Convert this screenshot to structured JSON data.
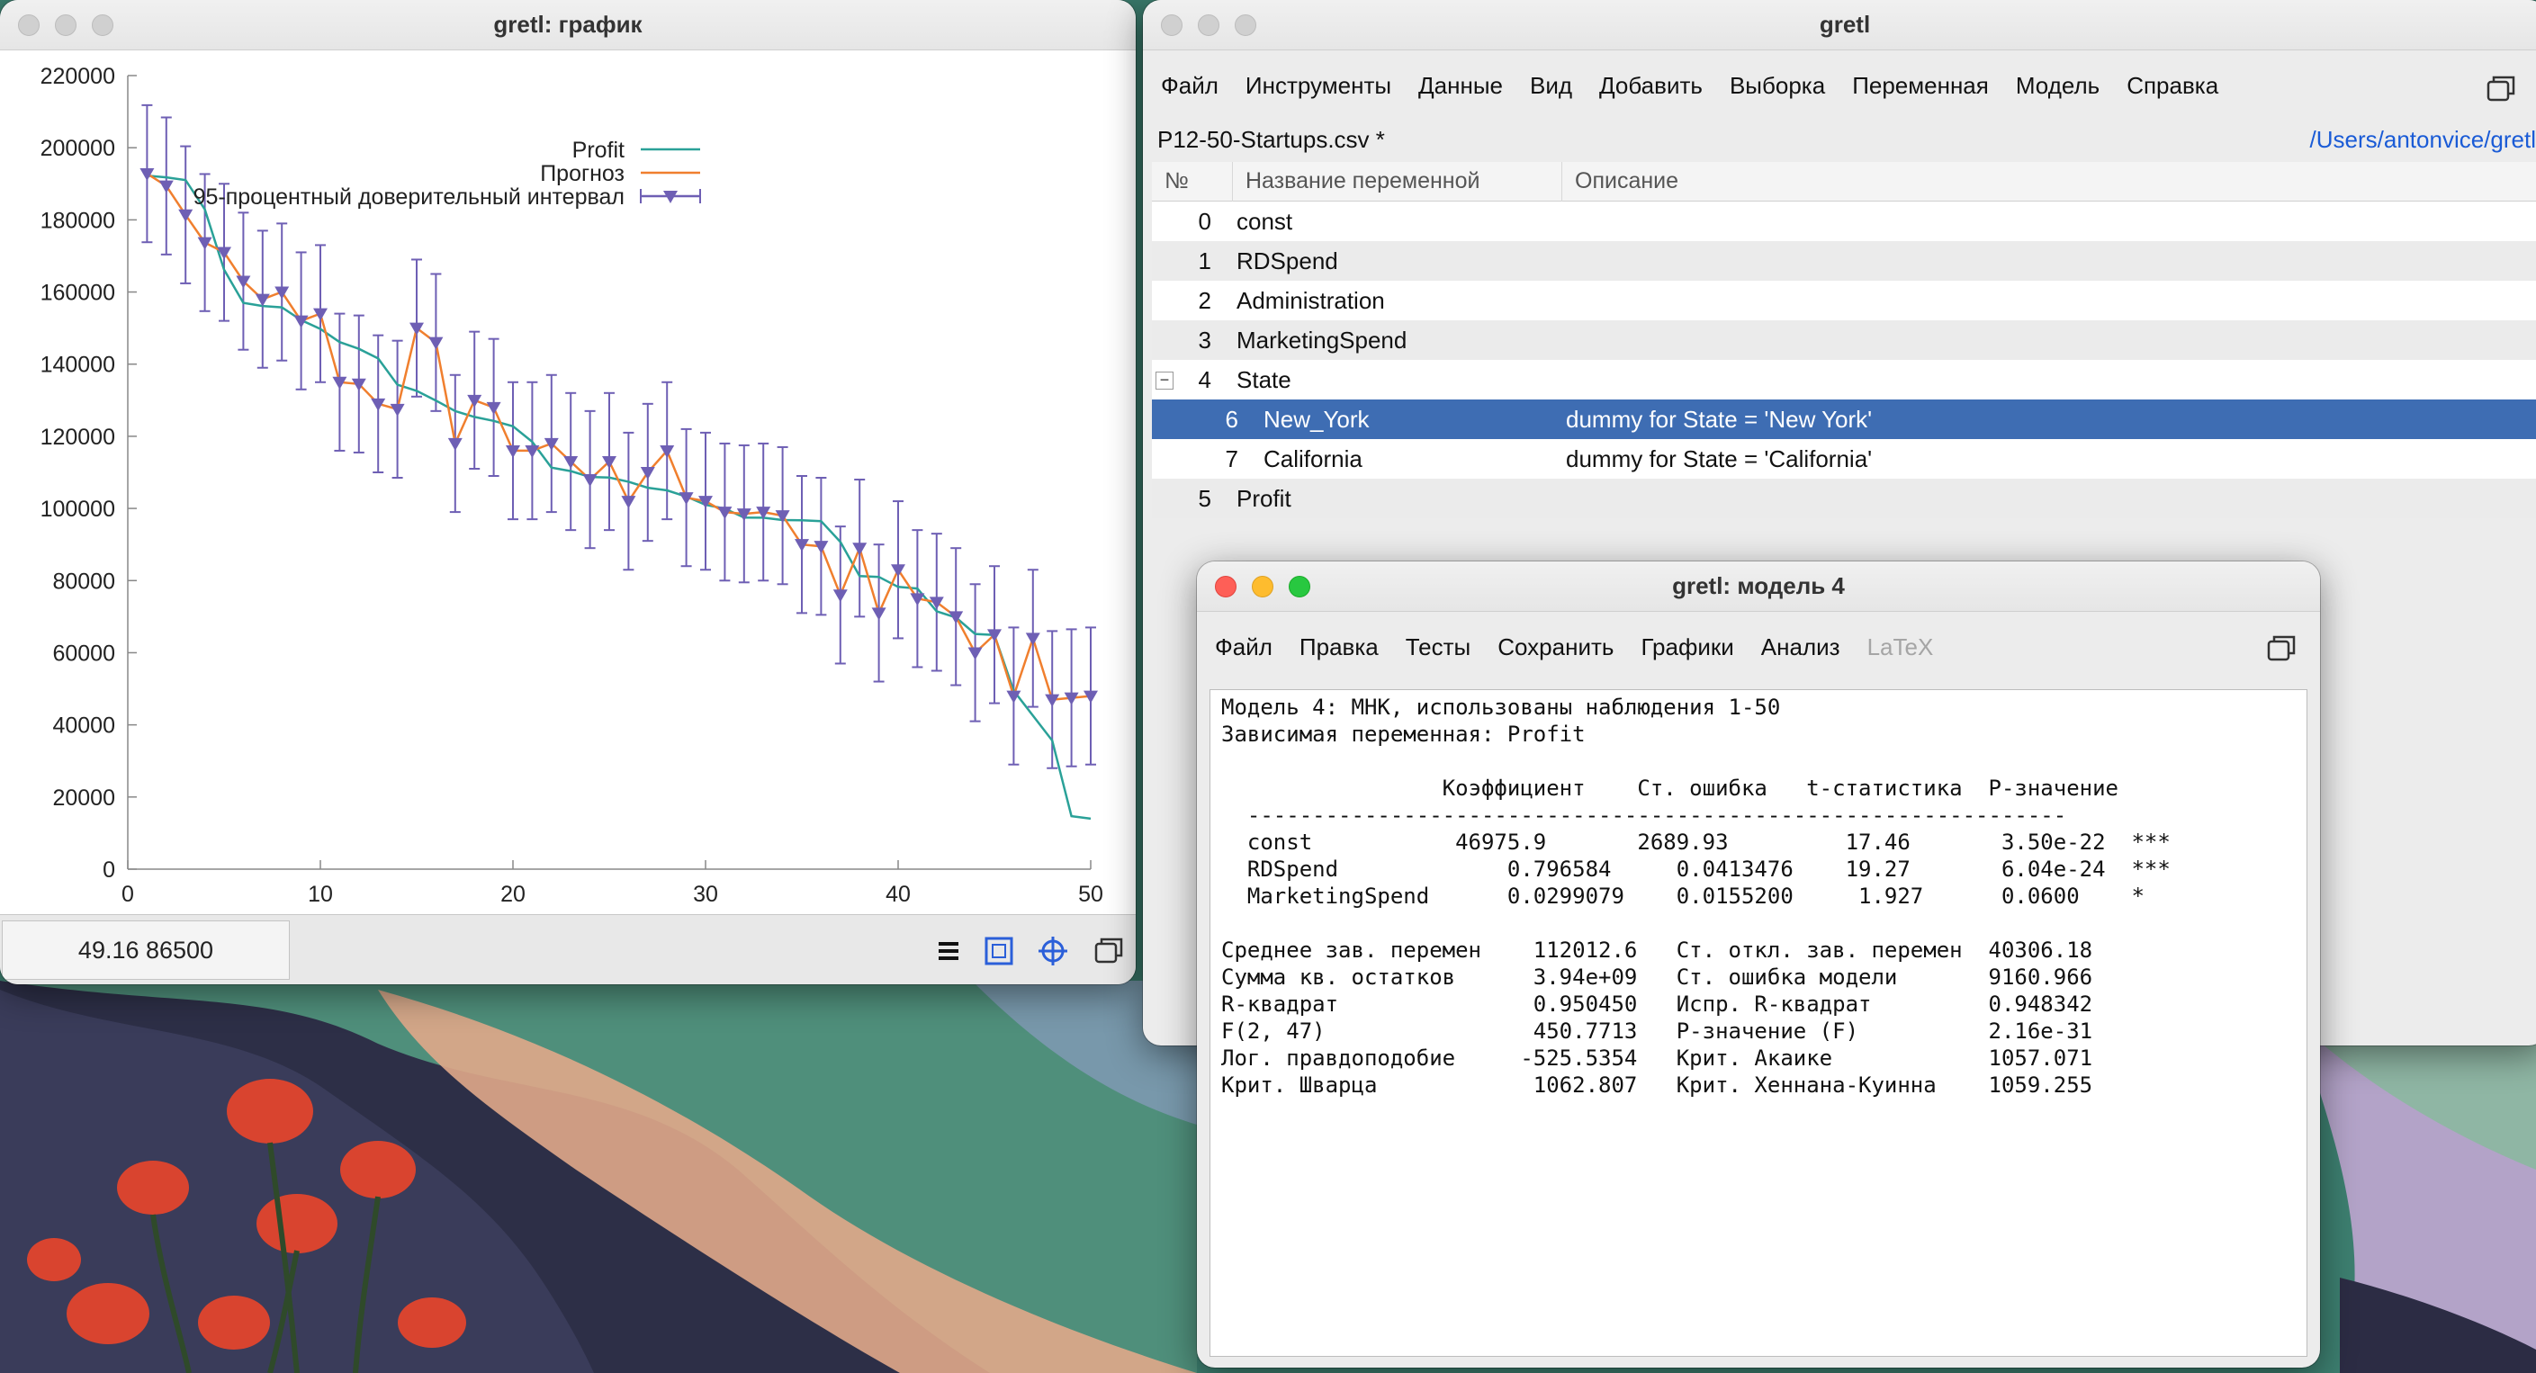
{
  "plot_window": {
    "title": "gretl: график",
    "coords": "49.16 86500",
    "toolbar_icons": [
      "menu-icon",
      "zoom-icon",
      "target-icon",
      "restore-icon"
    ]
  },
  "chart_data": {
    "type": "line",
    "title": "",
    "xlabel": "",
    "ylabel": "",
    "xlim": [
      0,
      50
    ],
    "ylim": [
      0,
      220000
    ],
    "xticks": [
      "0",
      "10",
      "20",
      "30",
      "40",
      "50"
    ],
    "yticks": [
      "0",
      "20000",
      "40000",
      "60000",
      "80000",
      "100000",
      "120000",
      "140000",
      "160000",
      "180000",
      "200000",
      "220000"
    ],
    "legend_position": "top-right",
    "series": [
      {
        "name": "Profit",
        "color": "#2aa198",
        "x": [
          1,
          2,
          3,
          4,
          5,
          6,
          7,
          8,
          9,
          10,
          11,
          12,
          13,
          14,
          15,
          16,
          17,
          18,
          19,
          20,
          21,
          22,
          23,
          24,
          25,
          26,
          27,
          28,
          29,
          30,
          31,
          32,
          33,
          34,
          35,
          36,
          37,
          38,
          39,
          40,
          41,
          42,
          43,
          44,
          45,
          46,
          47,
          48,
          49,
          50
        ],
        "y": [
          192262,
          191792,
          191050,
          182902,
          166188,
          156991,
          156123,
          155753,
          152212,
          149760,
          146122,
          144259,
          141586,
          134307,
          132603,
          129917,
          126993,
          125370,
          124267,
          122777,
          118474,
          111313,
          110352,
          108734,
          108552,
          107404,
          105734,
          105008,
          103282,
          101004,
          99938,
          97484,
          97427,
          96779,
          96713,
          96480,
          90709,
          81229,
          81006,
          78240,
          77798,
          71498,
          69759,
          65200,
          64926,
          49491,
          42560,
          35673,
          14681,
          14000
        ]
      },
      {
        "name": "Прогноз",
        "color": "#f07f2e",
        "x": [
          1,
          2,
          3,
          4,
          5,
          6,
          7,
          8,
          9,
          10,
          11,
          12,
          13,
          14,
          15,
          16,
          17,
          18,
          19,
          20,
          21,
          22,
          23,
          24,
          25,
          26,
          27,
          28,
          29,
          30,
          31,
          32,
          33,
          34,
          35,
          36,
          37,
          38,
          39,
          40,
          41,
          42,
          43,
          44,
          45,
          46,
          47,
          48,
          49,
          50
        ],
        "y": [
          192800,
          189400,
          181400,
          173700,
          171000,
          163000,
          158000,
          160000,
          152000,
          154000,
          135000,
          134500,
          129000,
          127500,
          150000,
          146000,
          118000,
          130000,
          128000,
          116000,
          116000,
          118000,
          113000,
          108000,
          113000,
          102000,
          110000,
          116000,
          103000,
          102000,
          99000,
          98500,
          99000,
          98000,
          90000,
          89500,
          76000,
          89000,
          71000,
          83000,
          75000,
          74000,
          70000,
          60000,
          65000,
          48000,
          64000,
          47000,
          47500,
          48000
        ]
      },
      {
        "name": "95-процентный доверительный интервал",
        "color": "#6e5fb4",
        "x": [
          1,
          2,
          3,
          4,
          5,
          6,
          7,
          8,
          9,
          10,
          11,
          12,
          13,
          14,
          15,
          16,
          17,
          18,
          19,
          20,
          21,
          22,
          23,
          24,
          25,
          26,
          27,
          28,
          29,
          30,
          31,
          32,
          33,
          34,
          35,
          36,
          37,
          38,
          39,
          40,
          41,
          42,
          43,
          44,
          45,
          46,
          47,
          48,
          49,
          50
        ],
        "y": [
          192800,
          189400,
          181400,
          173700,
          171000,
          163000,
          158000,
          160000,
          152000,
          154000,
          135000,
          134500,
          129000,
          127500,
          150000,
          146000,
          118000,
          130000,
          128000,
          116000,
          116000,
          118000,
          113000,
          108000,
          113000,
          102000,
          110000,
          116000,
          103000,
          102000,
          99000,
          98500,
          99000,
          98000,
          90000,
          89500,
          76000,
          89000,
          71000,
          83000,
          75000,
          74000,
          70000,
          60000,
          65000,
          48000,
          64000,
          47000,
          47500,
          48000
        ],
        "half_width": 19000
      }
    ]
  },
  "main_window": {
    "title": "gretl",
    "menu": [
      "Файл",
      "Инструменты",
      "Данные",
      "Вид",
      "Добавить",
      "Выборка",
      "Переменная",
      "Модель",
      "Справка"
    ],
    "file_name": "P12-50-Startups.csv *",
    "file_path": "/Users/antonvice/gretl",
    "table": {
      "headers": [
        "№",
        "Название переменной",
        "Описание"
      ],
      "rows": [
        {
          "no": "0",
          "name": "const",
          "desc": ""
        },
        {
          "no": "1",
          "name": "RDSpend",
          "desc": ""
        },
        {
          "no": "2",
          "name": "Administration",
          "desc": ""
        },
        {
          "no": "3",
          "name": "MarketingSpend",
          "desc": ""
        },
        {
          "no": "4",
          "name": "State",
          "desc": ""
        },
        {
          "no": "6",
          "name": "New_York",
          "desc": "dummy for State = 'New York'"
        },
        {
          "no": "7",
          "name": "California",
          "desc": "dummy for State = 'California'"
        },
        {
          "no": "5",
          "name": "Profit",
          "desc": ""
        }
      ]
    }
  },
  "model_window": {
    "title": "gretl: модель 4",
    "menu": [
      "Файл",
      "Правка",
      "Тесты",
      "Сохранить",
      "Графики",
      "Анализ"
    ],
    "menu_disabled": "LaTeX",
    "text_lines": [
      "Модель 4: МНК, использованы наблюдения 1-50",
      "Зависимая переменная: Profit",
      "",
      "                 Коэффициент    Ст. ошибка   t-статистика  P-значение",
      "  ---------------------------------------------------------------",
      "  const           46975.9       2689.93         17.46       3.50e-22  ***",
      "  RDSpend             0.796584     0.0413476    19.27       6.04e-24  ***",
      "  MarketingSpend      0.0299079    0.0155200     1.927      0.0600    *",
      "",
      "Среднее зав. перемен    112012.6   Ст. откл. зав. перемен  40306.18",
      "Сумма кв. остатков      3.94e+09   Ст. ошибка модели       9160.966",
      "R-квадрат               0.950450   Испр. R-квадрат         0.948342",
      "F(2, 47)                450.7713   P-значение (F)          2.16e-31",
      "Лог. правдоподобие     -525.5354   Крит. Акаике            1057.071",
      "Крит. Шварца            1062.807   Крит. Хеннана-Куинна    1059.255"
    ]
  }
}
